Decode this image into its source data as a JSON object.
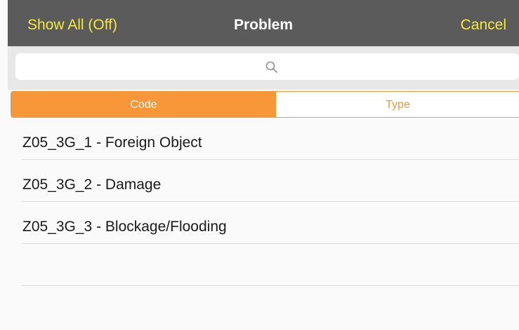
{
  "navbar": {
    "left_button": "Show All (Off)",
    "title": "Problem",
    "right_button": "Cancel"
  },
  "search": {
    "placeholder": "",
    "icon": "search-icon"
  },
  "segments": {
    "selected": "Code",
    "items": [
      "Code",
      "Type"
    ]
  },
  "list": {
    "items": [
      "Z05_3G_1 - Foreign Object",
      "Z05_3G_2 - Damage",
      "Z05_3G_3 - Blockage/Flooding",
      ""
    ]
  },
  "colors": {
    "navbar_bg": "#5b5b5b",
    "nav_button": "#f5e93a",
    "accent": "#f7973a"
  }
}
